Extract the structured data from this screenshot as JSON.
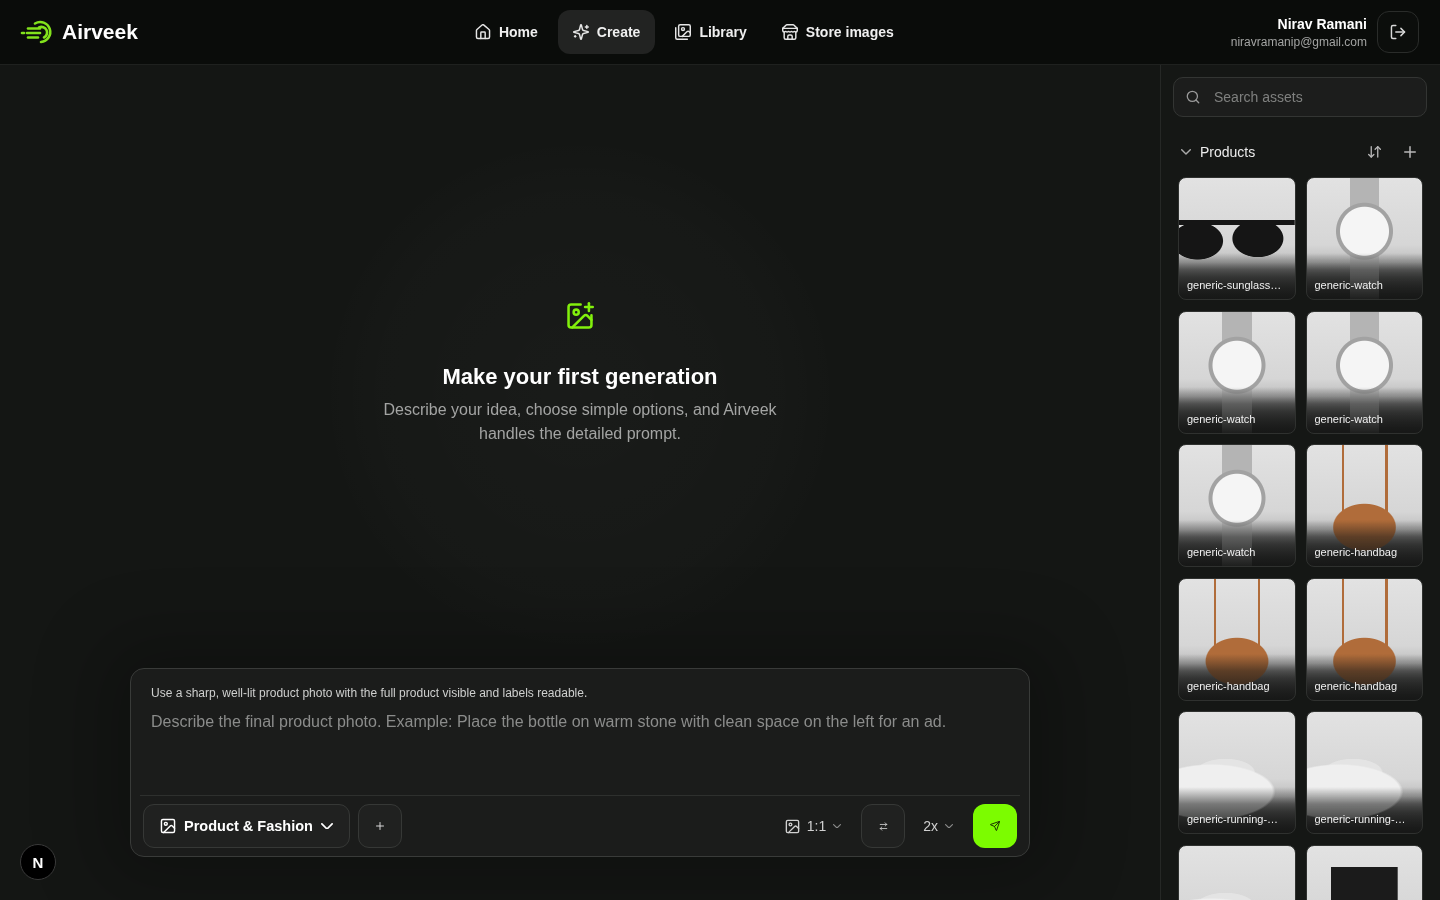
{
  "header": {
    "brand": "Airveek",
    "nav": [
      {
        "label": "Home",
        "selected": false
      },
      {
        "label": "Create",
        "selected": true
      },
      {
        "label": "Library",
        "selected": false
      },
      {
        "label": "Store images",
        "selected": false
      }
    ],
    "user": {
      "name": "Nirav Ramani",
      "email": "niravramanip@gmail.com"
    }
  },
  "empty_state": {
    "title": "Make your first generation",
    "description": "Describe your idea, choose simple options, and Airveek handles the detailed prompt."
  },
  "composer": {
    "hint": "Use a sharp, well-lit product photo with the full product visible and labels readable.",
    "placeholder": "Describe the final product photo. Example: Place the bottle on warm stone with clean space on the left for an ad.",
    "category": "Product & Fashion",
    "aspect_ratio": "1:1",
    "count": "2x"
  },
  "sidebar": {
    "search": {
      "placeholder": "Search assets"
    },
    "section": {
      "title": "Products",
      "expanded": true
    },
    "assets": [
      {
        "kind": "sunglasses",
        "label": "generic-sunglass…"
      },
      {
        "kind": "watch",
        "label": "generic-watch"
      },
      {
        "kind": "watch",
        "label": "generic-watch"
      },
      {
        "kind": "watch",
        "label": "generic-watch"
      },
      {
        "kind": "watch",
        "label": "generic-watch"
      },
      {
        "kind": "handbag",
        "label": "generic-handbag"
      },
      {
        "kind": "handbag",
        "label": "generic-handbag"
      },
      {
        "kind": "handbag",
        "label": "generic-handbag"
      },
      {
        "kind": "sneaker",
        "label": "generic-running-…"
      },
      {
        "kind": "sneaker",
        "label": "generic-running-…"
      },
      {
        "kind": "sneaker"
      },
      {
        "kind": "canister"
      }
    ]
  },
  "dev_badge": {
    "label": "N"
  }
}
